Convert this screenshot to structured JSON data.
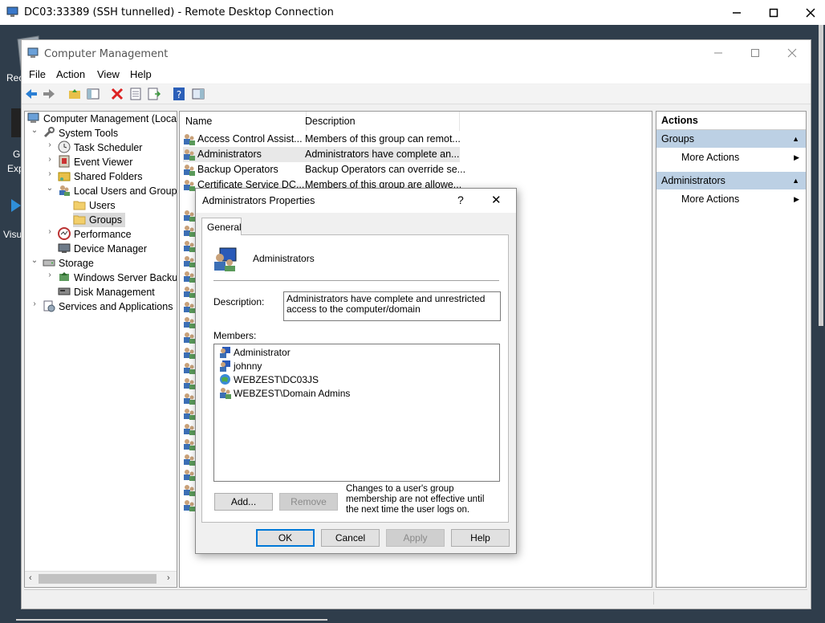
{
  "rdp": {
    "title": "DC03:33389 (SSH tunnelled) - Remote Desktop Connection"
  },
  "desktop": {
    "labels": [
      "Rec",
      "G",
      "Exp",
      "Visu"
    ]
  },
  "window": {
    "title": "Computer Management"
  },
  "menu": [
    "File",
    "Action",
    "View",
    "Help"
  ],
  "tree": {
    "root": "Computer Management (Local",
    "system_tools": "System Tools",
    "task_scheduler": "Task Scheduler",
    "event_viewer": "Event Viewer",
    "shared_folders": "Shared Folders",
    "local_users": "Local Users and Groups",
    "users": "Users",
    "groups": "Groups",
    "performance": "Performance",
    "device_manager": "Device Manager",
    "storage": "Storage",
    "wsb": "Windows Server Backup",
    "disk_mgmt": "Disk Management",
    "services": "Services and Applications"
  },
  "list": {
    "headers": {
      "name": "Name",
      "description": "Description"
    },
    "rows": [
      {
        "name": "Access Control Assist...",
        "description": "Members of this group can remot..."
      },
      {
        "name": "Administrators",
        "description": "Administrators have complete an..."
      },
      {
        "name": "Backup Operators",
        "description": "Backup Operators can override se..."
      },
      {
        "name": "Certificate Service DC...",
        "description": "Members of this group are allowe..."
      }
    ]
  },
  "actions": {
    "title": "Actions",
    "sections": [
      {
        "header": "Groups",
        "item": "More Actions"
      },
      {
        "header": "Administrators",
        "item": "More Actions"
      }
    ]
  },
  "dialog": {
    "title": "Administrators Properties",
    "help": "?",
    "close": "✕",
    "tab": "General",
    "group_name": "Administrators",
    "description_label": "Description:",
    "description_value": "Administrators have complete and unrestricted access to the computer/domain",
    "members_label": "Members:",
    "members": [
      "Administrator",
      "johnny",
      "WEBZEST\\DC03JS",
      "WEBZEST\\Domain Admins"
    ],
    "add_button": "Add...",
    "remove_button": "Remove",
    "note": "Changes to a user's group membership are not effective until the next time the user logs on.",
    "ok": "OK",
    "cancel": "Cancel",
    "apply": "Apply",
    "help_button": "Help"
  }
}
